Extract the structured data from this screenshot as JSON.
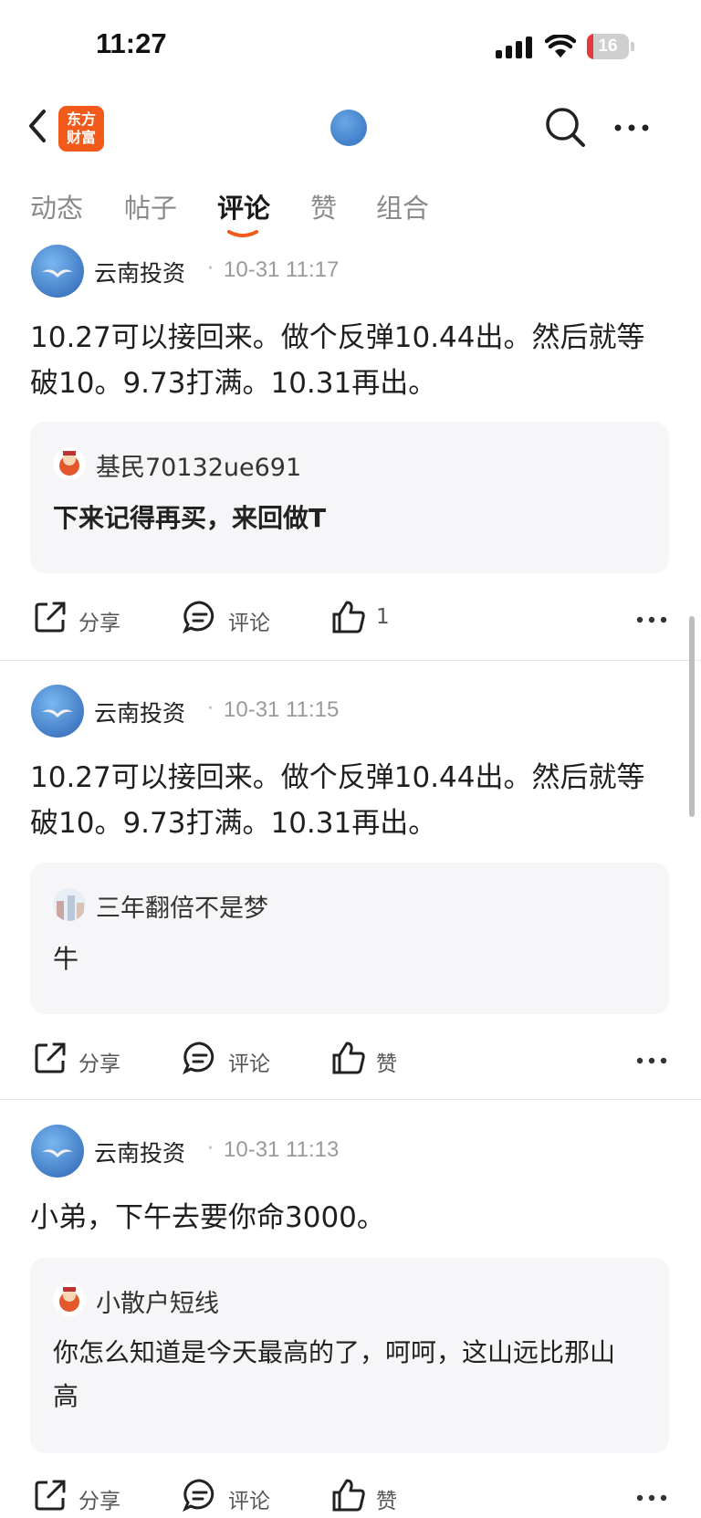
{
  "status_bar": {
    "time": "11:27",
    "battery": "16",
    "battery_level": 0.16
  },
  "header": {
    "logo_text_line1": "东方",
    "logo_text_line2": "财富"
  },
  "tabs": [
    {
      "label": "动态",
      "active": false
    },
    {
      "label": "帖子",
      "active": false
    },
    {
      "label": "评论",
      "active": true
    },
    {
      "label": "赞",
      "active": false
    },
    {
      "label": "组合",
      "active": false
    }
  ],
  "colors": {
    "accent": "#f25a1c",
    "reply_bg": "#f6f6f8",
    "avatar_blue": "#2c63b2"
  },
  "comments": [
    {
      "author": "云南投资",
      "dot": "·",
      "time": "10-31 11:17",
      "text": "10.27可以接回来。做个反弹10.44出。然后就等破10。9.73打满。10.31再出。",
      "reply": {
        "author": "基民70132ue691",
        "text": "下来记得再买，来回做T"
      },
      "actions": {
        "share": "分享",
        "comment": "评论",
        "like": "1"
      }
    },
    {
      "author": "云南投资",
      "dot": "·",
      "time": "10-31 11:15",
      "text": "10.27可以接回来。做个反弹10.44出。然后就等破10。9.73打满。10.31再出。",
      "reply": {
        "author": "三年翻倍不是梦",
        "text": "牛"
      },
      "actions": {
        "share": "分享",
        "comment": "评论",
        "like": "赞"
      }
    },
    {
      "author": "云南投资",
      "dot": "·",
      "time": "10-31 11:13",
      "text": "小弟，下午去要你命3000。",
      "reply": {
        "author": "小散户短线",
        "text": "你怎么知道是今天最高的了，呵呵，这山远比那山高"
      },
      "actions": {
        "share": "分享",
        "comment": "评论",
        "like": "赞"
      }
    }
  ]
}
